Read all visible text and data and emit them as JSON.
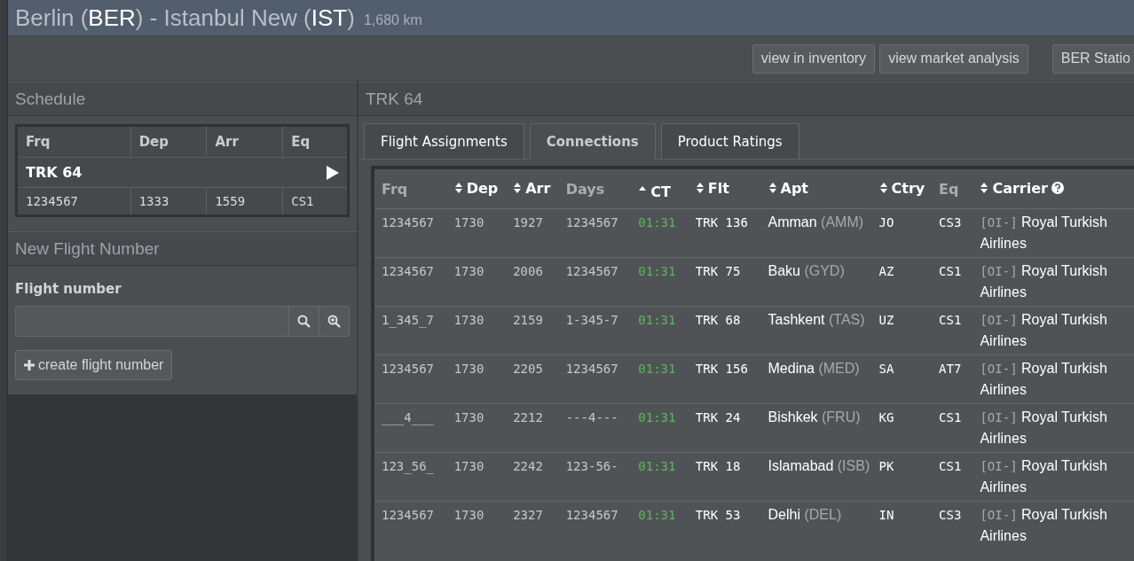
{
  "header": {
    "title": [
      {
        "kind": "plain",
        "text": "Berlin ("
      },
      {
        "kind": "code",
        "text": "BER"
      },
      {
        "kind": "plain",
        "text": ") - Istanbul New ("
      },
      {
        "kind": "code",
        "text": "IST"
      },
      {
        "kind": "plain",
        "text": ")"
      }
    ],
    "distance": "1,680 km"
  },
  "toolbar": {
    "buttons": [
      "view in inventory",
      "view market analysis"
    ],
    "station_button": "BER Statio"
  },
  "schedule": {
    "title": "Schedule",
    "columns": [
      "Frq",
      "Dep",
      "Arr",
      "Eq"
    ],
    "groups": [
      {
        "label": "TRK 64",
        "rows": [
          [
            "1234567",
            "1333",
            "1559",
            "CS1"
          ]
        ]
      }
    ]
  },
  "new_flight": {
    "title": "New Flight Number",
    "label": "Flight number",
    "create_button": "create flight number"
  },
  "detail": {
    "title": "TRK 64",
    "tabs": [
      {
        "label": "Flight Assignments",
        "selected": false
      },
      {
        "label": "Connections",
        "selected": true
      },
      {
        "label": "Product Ratings",
        "selected": false
      }
    ],
    "table": {
      "columns": [
        {
          "label": "Frq",
          "sortable": false,
          "sorted": false
        },
        {
          "label": "Dep",
          "sortable": true,
          "sorted": false
        },
        {
          "label": "Arr",
          "sortable": true,
          "sorted": false
        },
        {
          "label": "Days",
          "sortable": false,
          "sorted": false
        },
        {
          "label": "CT",
          "sortable": true,
          "sorted": true
        },
        {
          "label": "Flt",
          "sortable": true,
          "sorted": false
        },
        {
          "label": "Apt",
          "sortable": true,
          "sorted": false
        },
        {
          "label": "Ctry",
          "sortable": true,
          "sorted": false
        },
        {
          "label": "Eq",
          "sortable": false,
          "sorted": false
        },
        {
          "label": "Carrier",
          "sortable": true,
          "sorted": false,
          "help": true
        }
      ],
      "rows": [
        {
          "frq": "1234567",
          "dep": "1730",
          "arr": "1927",
          "days": "1234567",
          "ct": "01:31",
          "flt": "TRK 136",
          "city": "Amman",
          "code": "(AMM)",
          "ctry": "JO",
          "eq": "CS3",
          "carrier_code": "[OI-]",
          "carrier": "Royal Turkish Airlines"
        },
        {
          "frq": "1234567",
          "dep": "1730",
          "arr": "2006",
          "days": "1234567",
          "ct": "01:31",
          "flt": "TRK 75",
          "city": "Baku",
          "code": "(GYD)",
          "ctry": "AZ",
          "eq": "CS1",
          "carrier_code": "[OI-]",
          "carrier": "Royal Turkish Airlines"
        },
        {
          "frq": "1_345_7",
          "dep": "1730",
          "arr": "2159",
          "days": "1-345-7",
          "ct": "01:31",
          "flt": "TRK 68",
          "city": "Tashkent",
          "code": "(TAS)",
          "ctry": "UZ",
          "eq": "CS1",
          "carrier_code": "[OI-]",
          "carrier": "Royal Turkish Airlines"
        },
        {
          "frq": "1234567",
          "dep": "1730",
          "arr": "2205",
          "days": "1234567",
          "ct": "01:31",
          "flt": "TRK 156",
          "city": "Medina",
          "code": "(MED)",
          "ctry": "SA",
          "eq": "AT7",
          "carrier_code": "[OI-]",
          "carrier": "Royal Turkish Airlines"
        },
        {
          "frq": "___4___",
          "dep": "1730",
          "arr": "2212",
          "days": "---4---",
          "ct": "01:31",
          "flt": "TRK 24",
          "city": "Bishkek",
          "code": "(FRU)",
          "ctry": "KG",
          "eq": "CS1",
          "carrier_code": "[OI-]",
          "carrier": "Royal Turkish Airlines"
        },
        {
          "frq": "123_56_",
          "dep": "1730",
          "arr": "2242",
          "days": "123-56-",
          "ct": "01:31",
          "flt": "TRK 18",
          "city": "Islamabad",
          "code": "(ISB)",
          "ctry": "PK",
          "eq": "CS1",
          "carrier_code": "[OI-]",
          "carrier": "Royal Turkish Airlines"
        },
        {
          "frq": "1234567",
          "dep": "1730",
          "arr": "2327",
          "days": "1234567",
          "ct": "01:31",
          "flt": "TRK 53",
          "city": "Delhi",
          "code": "(DEL)",
          "ctry": "IN",
          "eq": "CS3",
          "carrier_code": "[OI-]",
          "carrier": "Royal Turkish Airlines"
        }
      ]
    }
  }
}
